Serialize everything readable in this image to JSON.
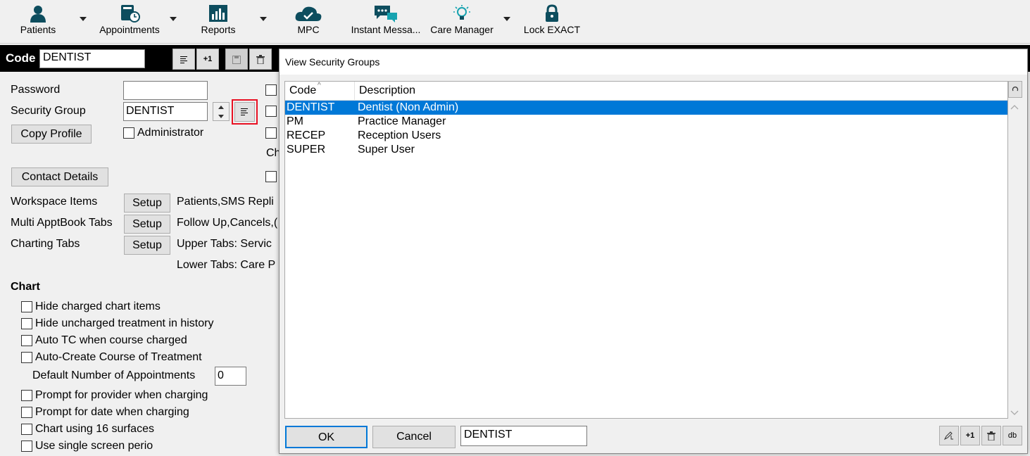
{
  "toolbar": {
    "items": [
      {
        "label": "Patients",
        "icon": "person-icon"
      },
      {
        "label": "Appointments",
        "icon": "appointment-book-icon"
      },
      {
        "label": "Reports",
        "icon": "report-chart-icon"
      },
      {
        "label": "MPC",
        "icon": "cloud-check-icon"
      },
      {
        "label": "Instant Messa...",
        "icon": "chat-bubbles-icon"
      },
      {
        "label": "Care Manager",
        "icon": "lightbulb-icon"
      },
      {
        "label": "Lock EXACT",
        "icon": "padlock-icon"
      }
    ],
    "brand_color": "#0d4d5e"
  },
  "codebar": {
    "label": "Code",
    "value": "DENTIST",
    "plus_one": "+1"
  },
  "form": {
    "password_label": "Password",
    "password_value": "",
    "security_group_label": "Security Group",
    "security_group_value": "DENTIST",
    "copy_profile": "Copy Profile",
    "administrator_label": "Administrator",
    "partial_ch": "Ch",
    "contact_details": "Contact Details",
    "workspace_items_label": "Workspace Items",
    "multi_apptbook_label": "Multi ApptBook Tabs",
    "charting_tabs_label": "Charting Tabs",
    "setup_label": "Setup",
    "workspace_value": "Patients,SMS Repli",
    "multi_apptbook_value": "Follow Up,Cancels,(",
    "upper_tabs_value": "Upper Tabs: Servic",
    "lower_tabs_value": "Lower Tabs: Care P",
    "chart_heading": "Chart",
    "chart_options": [
      "Hide charged chart items",
      "Hide uncharged treatment in history",
      "Auto TC when course charged",
      "Auto-Create Course of Treatment"
    ],
    "default_appts_label": "Default Number of Appointments",
    "default_appts_value": "0",
    "chart_options2": [
      "Prompt for provider when charging",
      "Prompt for date when charging",
      "Chart using 16 surfaces",
      "Use single screen perio"
    ]
  },
  "dialog": {
    "title": "View Security Groups",
    "columns": [
      "Code",
      "Description"
    ],
    "rows": [
      {
        "code": "DENTIST",
        "description": "Dentist (Non Admin)",
        "selected": true
      },
      {
        "code": "PM",
        "description": "Practice Manager",
        "selected": false
      },
      {
        "code": "RECEP",
        "description": "Reception Users",
        "selected": false
      },
      {
        "code": "SUPER",
        "description": "Super User",
        "selected": false
      }
    ],
    "ok_label": "OK",
    "cancel_label": "Cancel",
    "filter_value": "DENTIST",
    "plus_one": "+1",
    "db_label": "db",
    "selection_color": "#0078d7"
  }
}
